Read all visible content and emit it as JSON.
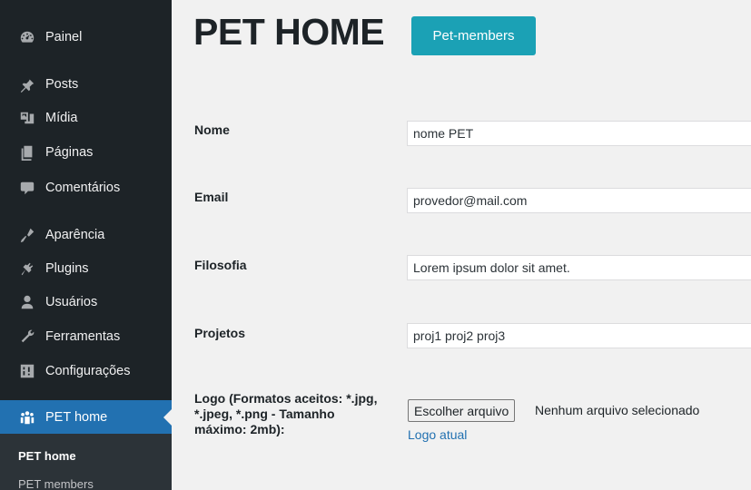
{
  "sidebar": {
    "items": [
      {
        "label": "Painel",
        "icon": "dashboard-icon"
      },
      {
        "label": "Posts",
        "icon": "pin-icon"
      },
      {
        "label": "Mídia",
        "icon": "media-icon"
      },
      {
        "label": "Páginas",
        "icon": "pages-icon"
      },
      {
        "label": "Comentários",
        "icon": "comments-icon"
      },
      {
        "label": "Aparência",
        "icon": "appearance-icon"
      },
      {
        "label": "Plugins",
        "icon": "plugins-icon"
      },
      {
        "label": "Usuários",
        "icon": "users-icon"
      },
      {
        "label": "Ferramentas",
        "icon": "tools-icon"
      },
      {
        "label": "Configurações",
        "icon": "settings-icon"
      },
      {
        "label": "PET home",
        "icon": "groups-icon",
        "current": true
      }
    ],
    "submenu": [
      {
        "label": "PET home",
        "active": true
      },
      {
        "label": "PET members",
        "active": false
      }
    ]
  },
  "main": {
    "title": "PET HOME",
    "members_button": "Pet-members",
    "fields": [
      {
        "label": "Nome",
        "value": "nome PET"
      },
      {
        "label": "Email",
        "value": "provedor@mail.com"
      },
      {
        "label": "Filosofia",
        "value": "Lorem ipsum dolor sit amet."
      },
      {
        "label": "Projetos",
        "value": "proj1 proj2 proj3"
      }
    ],
    "logo": {
      "label_line1": "Logo (Formatos aceitos: *.jpg,",
      "label_line2": "*.jpeg, *.png - Tamanho",
      "label_line3": "máximo: 2mb):",
      "file_button": "Escolher arquivo",
      "file_status": "Nenhum arquivo selecionado",
      "current_link": "Logo atual"
    }
  },
  "colors": {
    "sidebar_bg": "#1d2327",
    "active_menu": "#2271b1",
    "button_accent": "#1ba1b5",
    "link": "#2271b1"
  }
}
